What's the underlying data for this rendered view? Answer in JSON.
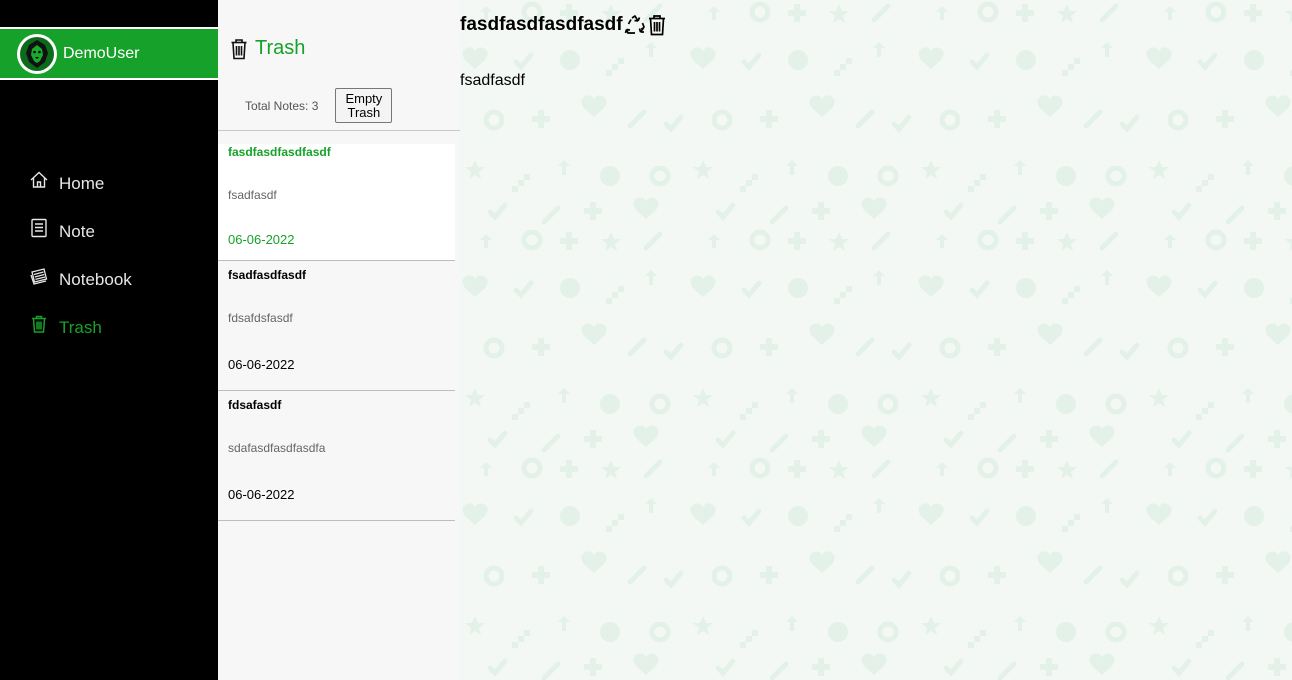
{
  "user": {
    "name": "DemoUser",
    "avatar_icon": "lion-avatar-icon"
  },
  "nav": [
    {
      "label": "Home",
      "icon": "home-icon",
      "active": false
    },
    {
      "label": "Note",
      "icon": "note-icon",
      "active": false
    },
    {
      "label": "Notebook",
      "icon": "notebook-icon",
      "active": false
    },
    {
      "label": "Trash",
      "icon": "trash-icon",
      "active": true
    }
  ],
  "panel": {
    "title": "Trash",
    "total_label": "Total Notes: 3",
    "empty_button_line1": "Empty",
    "empty_button_line2": "Trash"
  },
  "notes": [
    {
      "title": "fasdfasdfasdfasdf",
      "body": "fsadfasdf",
      "date": "06-06-2022",
      "selected": true
    },
    {
      "title": "fsadfasdfasdf",
      "body": "fdsafdsfasdf",
      "date": "06-06-2022",
      "selected": false
    },
    {
      "title": "fdsafasdf",
      "body": "sdafasdfasdfasdfa",
      "date": "06-06-2022",
      "selected": false
    }
  ],
  "editor": {
    "title": "fasdfasdfasdfasdf",
    "body": "fsadfasdf",
    "restore_icon": "recycle-icon",
    "delete_icon": "trash-icon"
  },
  "colors": {
    "accent": "#16a22a",
    "sidebar_bg": "#000000",
    "list_bg": "#f7f7f7",
    "main_bg": "#f3f8f5",
    "pattern": "#e3f1e8"
  }
}
